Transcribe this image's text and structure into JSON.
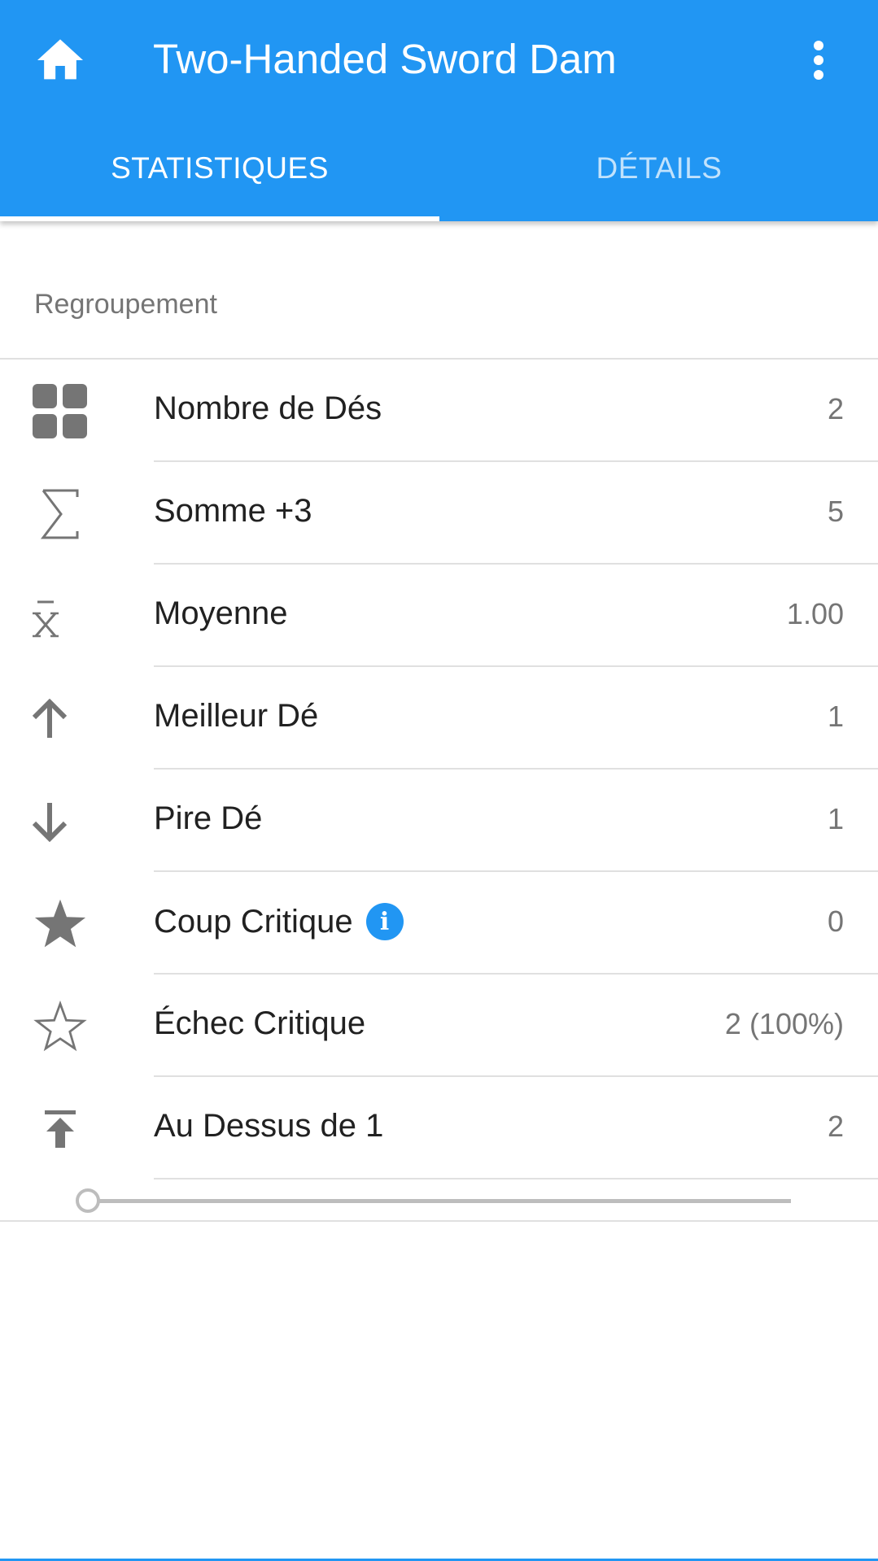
{
  "appbar": {
    "title": "Two-Handed Sword Dam",
    "home_icon": "home-icon",
    "menu_icon": "more-vertical-icon",
    "color": "#2196f3"
  },
  "tabs": [
    {
      "label": "STATISTIQUES",
      "active": true
    },
    {
      "label": "DÉTAILS",
      "active": false
    }
  ],
  "section": {
    "header": "Regroupement"
  },
  "stats": [
    {
      "icon": "grid-icon",
      "label": "Nombre de Dés",
      "value": "2"
    },
    {
      "icon": "sigma-icon",
      "label": "Somme +3",
      "value": "5"
    },
    {
      "icon": "mean-icon",
      "label": "Moyenne",
      "value": "1.00"
    },
    {
      "icon": "arrow-up-icon",
      "label": "Meilleur Dé",
      "value": "1"
    },
    {
      "icon": "arrow-down-icon",
      "label": "Pire Dé",
      "value": "1"
    },
    {
      "icon": "star-filled-icon",
      "label": "Coup Critique",
      "value": "0",
      "info_icon": "info-icon"
    },
    {
      "icon": "star-outline-icon",
      "label": "Échec Critique",
      "value": "2 (100%)"
    },
    {
      "icon": "upload-to-top-icon",
      "label": "Au Dessus de 1",
      "value": "2"
    }
  ],
  "threshold_slider": {
    "value_fraction": 0.0
  },
  "colors": {
    "accent": "#2196f3",
    "icon_gray": "#757575",
    "text": "#212121"
  }
}
